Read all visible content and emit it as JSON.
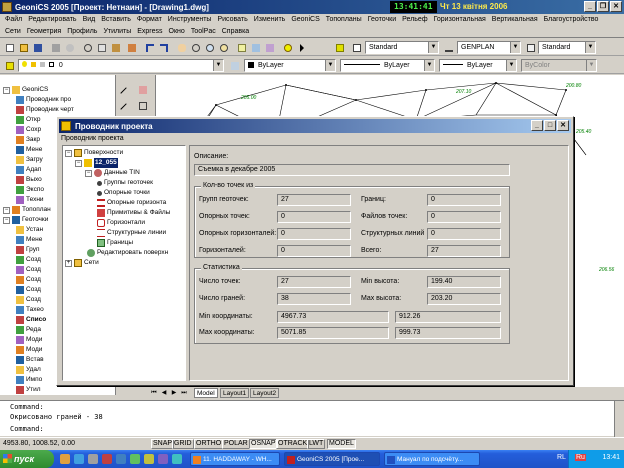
{
  "window": {
    "title": "GeoniCS 2005 [Проект: Нетнаин] - [Drawing1.dwg]",
    "clock": "13:41:41",
    "date": "Чт 13 квітня 2006",
    "buttons": {
      "minimize": "_",
      "restore": "❐",
      "close": "✕"
    }
  },
  "menu1": [
    "Файл",
    "Редактировать",
    "Вид",
    "Вставить",
    "Формат",
    "Инструменты",
    "Рисовать",
    "Изменить",
    "GeoniCS",
    "Топопланы",
    "Геоточки",
    "Рельеф",
    "Горизонтальная",
    "Вертикальная",
    "Благоустройство"
  ],
  "menu2": [
    "Сети",
    "Геометрия",
    "Профиль",
    "Утилиты",
    "Express",
    "Окно",
    "ToolPac",
    "Справка"
  ],
  "toolbar": {
    "text_style": "Standard",
    "dim_style": "GENPLAN",
    "table_style": "Standard",
    "layer": "0",
    "color": "ByLayer",
    "linetype": "ByLayer",
    "lineweight": "ByLayer",
    "plotstyle": "ByColor",
    "colors": {
      "green": "#18a018",
      "red": "#d02020",
      "blue": "#2040c0",
      "yellow": "#e8c000"
    }
  },
  "background_tree": [
    {
      "label": "GeoniCS",
      "level": 0
    },
    {
      "label": "Проводник про",
      "level": 1
    },
    {
      "label": "Проводник черт",
      "level": 1
    },
    {
      "label": "Откр",
      "level": 1
    },
    {
      "label": "Сохр",
      "level": 1
    },
    {
      "label": "Закр",
      "level": 1
    },
    {
      "label": "Мене",
      "level": 1
    },
    {
      "label": "Загру",
      "level": 1
    },
    {
      "label": "Адап",
      "level": 1
    },
    {
      "label": "Выхо",
      "level": 1
    },
    {
      "label": "Экспо",
      "level": 1
    },
    {
      "label": "Техни",
      "level": 1
    },
    {
      "label": "Топоплан",
      "level": 0
    },
    {
      "label": "Геоточки",
      "level": 0
    },
    {
      "label": "Устан",
      "level": 1
    },
    {
      "label": "Мене",
      "level": 1
    },
    {
      "label": "Груп",
      "level": 1
    },
    {
      "label": "Созд",
      "level": 1
    },
    {
      "label": "Созд",
      "level": 1
    },
    {
      "label": "Созд",
      "level": 1
    },
    {
      "label": "Созд",
      "level": 1
    },
    {
      "label": "Созд",
      "level": 1
    },
    {
      "label": "Тахео",
      "level": 1
    },
    {
      "label": "Списо",
      "level": 1
    },
    {
      "label": "Реда",
      "level": 1
    },
    {
      "label": "Моди",
      "level": 1
    },
    {
      "label": "Моди",
      "level": 1
    },
    {
      "label": "Встав",
      "level": 1
    },
    {
      "label": "Удал",
      "level": 1
    },
    {
      "label": "Импо",
      "level": 1
    },
    {
      "label": "Утил",
      "level": 1
    }
  ],
  "drawing_labels": [
    "205.00",
    "200.80",
    "205.40",
    "207.10",
    "206.56"
  ],
  "dialog": {
    "title": "Проводник проекта",
    "menu": "Проводник проекта",
    "tree": {
      "root": "Поверхности",
      "surface": "12_055",
      "tin": "Данные TIN",
      "tin_items": [
        "Группы геоточек",
        "Опорные точки",
        "Опорные горизонта",
        "Примитивы & Файлы",
        "Горизонтали",
        "Структурные линии",
        "Границы"
      ],
      "edit_surface": "Редактировать поверхн",
      "networks": "Сети"
    },
    "description_label": "Описание:",
    "description": "Съемка в декабре 2005",
    "counts": {
      "group_title": "Кол-во точек из",
      "groups_label": "Групп геоточек:",
      "groups": "27",
      "boundaries_label": "Границ:",
      "boundaries": "0",
      "ref_points_label": "Опорных точек:",
      "ref_points": "0",
      "point_files_label": "Файлов точек:",
      "point_files": "0",
      "ref_contours_label": "Опорных горизонталей:",
      "ref_contours": "0",
      "breaklines_label": "Структурных линий",
      "breaklines": "0",
      "contours_label": "Горизонталей:",
      "contours": "0",
      "total_label": "Всего:",
      "total": "27"
    },
    "stats": {
      "group_title": "Статистика",
      "points_label": "Число точек:",
      "points": "27",
      "min_elev_label": "Min высота:",
      "min_elev": "199.40",
      "faces_label": "Число граней:",
      "faces": "38",
      "max_elev_label": "Max высота:",
      "max_elev": "203.20",
      "min_coord_label": "Min координаты:",
      "min_x": "4967.73",
      "min_y": "912.26",
      "max_coord_label": "Max координаты:",
      "max_x": "5071.85",
      "max_y": "999.73"
    }
  },
  "tabs": [
    "Model",
    "Layout1",
    "Layout2"
  ],
  "command": {
    "line1": "Command:",
    "line2": "Окрисовано граней - 38",
    "line3": "Command:"
  },
  "status": {
    "coords": "4953.80, 1008.52, 0.00",
    "buttons": [
      "SNAP",
      "GRID",
      "ORTHO",
      "POLAR",
      "OSNAP",
      "OTRACK",
      "LWT",
      "MODEL"
    ]
  },
  "taskbar": {
    "start": "пуск",
    "tasks": [
      "11. HADDAWAY - WH...",
      "GeoniCS 2005 [Прое...",
      "Мануал по подсчёту..."
    ],
    "lang": "RL",
    "lang2": "Ru",
    "time": "13:41"
  }
}
